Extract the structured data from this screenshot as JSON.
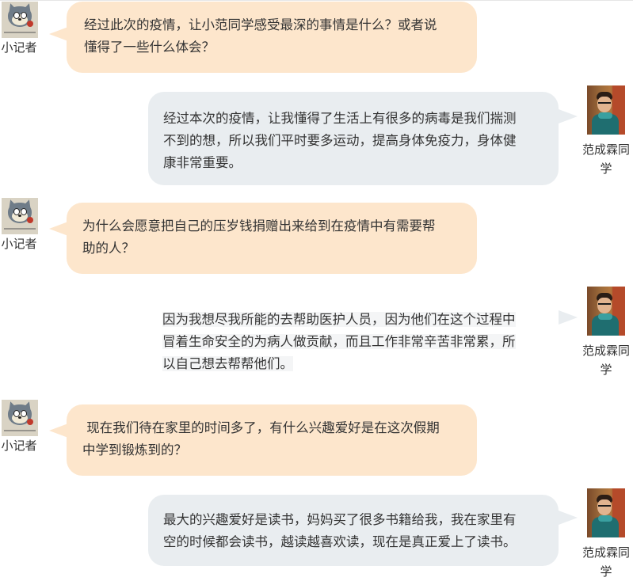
{
  "conversation": [
    {
      "side": "left",
      "speaker": "小记者",
      "lines": [
        "经过此次的疫情，让小范同学感受最深的事情是什么？或者说",
        "懂得了一些什么体会？"
      ]
    },
    {
      "side": "right",
      "speaker_lines": [
        "范成霖同",
        "学"
      ],
      "lines": [
        "经过本次的疫情，让我懂得了生活上有很多的病毒是我们揣测",
        "不到的想，所以我们平时要多运动，提高身体免疫力，身体健",
        "康非常重要。"
      ]
    },
    {
      "side": "left",
      "speaker": "小记者",
      "lines": [
        "为什么会愿意把自己的压岁钱捐赠出来给到在疫情中有需要帮",
        "助的人？"
      ]
    },
    {
      "side": "right",
      "speaker_lines": [
        "范成霖同",
        "学"
      ],
      "lines": [
        "因为我想尽我所能的去帮助医护人员，因为他们在这个过程中",
        "冒着生命安全的为病人做贡献，而且工作非常辛苦非常累，所",
        "以自己想去帮帮他们。"
      ]
    },
    {
      "side": "left",
      "speaker": "小记者",
      "lines": [
        " 现在我们待在家里的时间多了，有什么兴趣爱好是在这次假期",
        "中学到锻炼到的？"
      ]
    },
    {
      "side": "right",
      "speaker_lines": [
        "范成霖同",
        "学"
      ],
      "lines": [
        "最大的兴趣爱好是读书，妈妈买了很多书籍给我，我在家里有",
        "空的时候都会读书，越读越喜欢读，现在是真正爱上了读书。"
      ]
    }
  ],
  "colors": {
    "interviewer_bubble": "#fde6cc",
    "student_bubble": "#e9edf0"
  },
  "icons": {
    "interviewer_avatar": "cartoon-cat-avatar",
    "student_avatar": "student-photo-avatar"
  }
}
